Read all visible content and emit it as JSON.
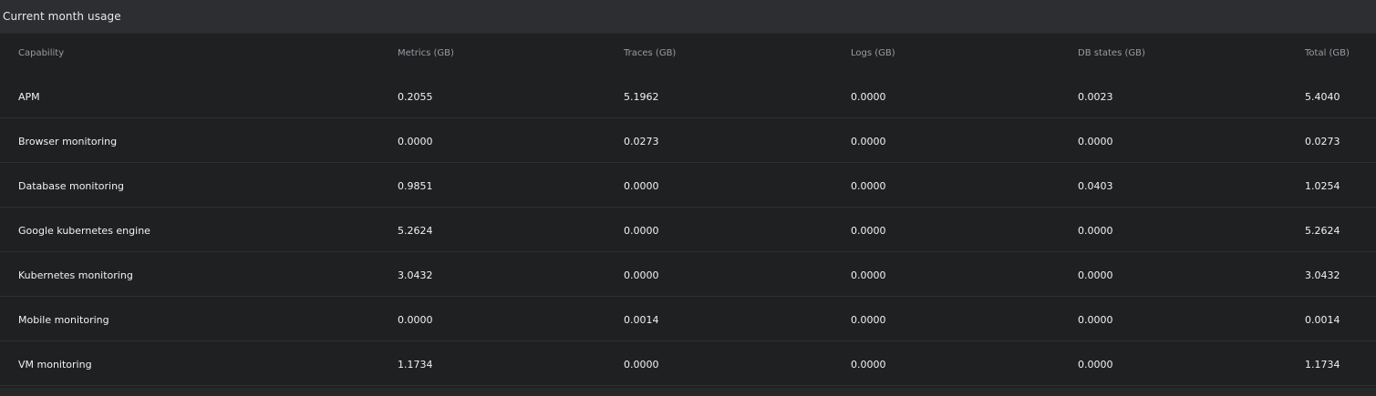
{
  "panel": {
    "title": "Current month usage"
  },
  "table": {
    "columns": [
      "Capability",
      "Metrics (GB)",
      "Traces (GB)",
      "Logs (GB)",
      "DB states (GB)",
      "Total (GB)"
    ],
    "rows": [
      [
        "APM",
        "0.2055",
        "5.1962",
        "0.0000",
        "0.0023",
        "5.4040"
      ],
      [
        "Browser monitoring",
        "0.0000",
        "0.0273",
        "0.0000",
        "0.0000",
        "0.0273"
      ],
      [
        "Database monitoring",
        "0.9851",
        "0.0000",
        "0.0000",
        "0.0403",
        "1.0254"
      ],
      [
        "Google kubernetes engine",
        "5.2624",
        "0.0000",
        "0.0000",
        "0.0000",
        "5.2624"
      ],
      [
        "Kubernetes monitoring",
        "3.0432",
        "0.0000",
        "0.0000",
        "0.0000",
        "3.0432"
      ],
      [
        "Mobile monitoring",
        "0.0000",
        "0.0014",
        "0.0000",
        "0.0000",
        "0.0014"
      ],
      [
        "VM monitoring",
        "1.1734",
        "0.0000",
        "0.0000",
        "0.0000",
        "1.1734"
      ]
    ]
  },
  "colors": {
    "panel_background": "#1f2022",
    "header_background": "#2c2e31",
    "row_divider": "#2e3034",
    "header_text": "#9a9ca1",
    "cell_text": "#f1f2f4"
  }
}
